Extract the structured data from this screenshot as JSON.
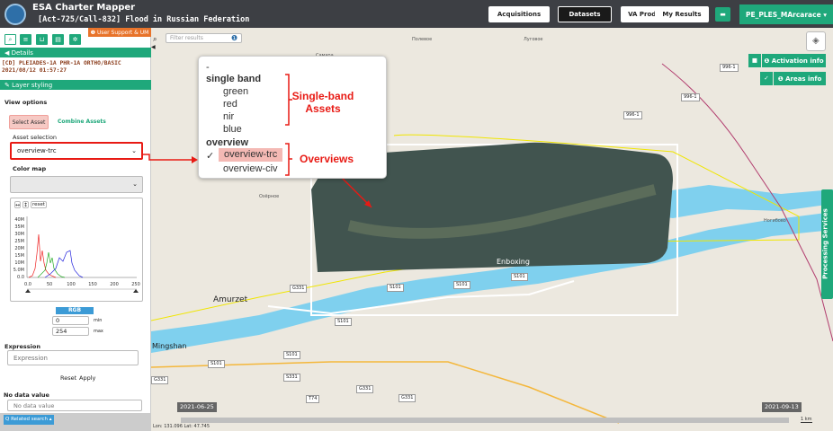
{
  "header": {
    "app_title": "ESA Charter Mapper",
    "subtitle": "[Act-725/Call-832] Flood in Russian Federation",
    "nav": [
      "Acquisitions",
      "Datasets",
      "VA Products",
      "My Results"
    ],
    "user": "PE_PLES_MArcarace ▾"
  },
  "panel": {
    "user_support": "❶ User Support & UM",
    "details_label": "Details",
    "dataset_title": "[CD] PLEIADES-1A PHR-1A ORTHO/BASIC 2021/08/12 01:57:27",
    "layer_styling": "Layer styling",
    "view_options": "View options",
    "tabs": [
      "Select Asset",
      "Combine Assets"
    ],
    "asset_selection_label": "Asset selection",
    "asset_value": "overview-trc",
    "color_map_label": "Color map",
    "hist_buttons": [
      "↔",
      "↕",
      "reset"
    ],
    "hist_y": [
      "40M",
      "35M",
      "30M",
      "25M",
      "20M",
      "15M",
      "10M",
      "5.0M",
      "0.0"
    ],
    "hist_x": [
      "0.0",
      "50",
      "100",
      "150",
      "200",
      "250"
    ],
    "rgb_label": "RGB",
    "min_value": "0",
    "min_label": "min",
    "max_value": "254",
    "max_label": "max",
    "expression_label": "Expression",
    "expression_placeholder": "Expression",
    "reset_label": "Reset",
    "apply_label": "Apply",
    "nodata_label": "No data value",
    "nodata_placeholder": "No data value",
    "related_search": "Q Related search ▴"
  },
  "map": {
    "filter_placeholder": "Filter results",
    "activation_info": "❶ Activation info",
    "areas_info": "❶ Areas info",
    "processing_services": "Processing Services",
    "places": [
      "Amurzet",
      "Mingshan",
      "Enboxing",
      "Самара",
      "Полевое",
      "Луговое",
      "Озёрное",
      "Ногибово"
    ],
    "roads": [
      "S101",
      "S101",
      "S101",
      "S101",
      "S101",
      "S101",
      "S331",
      "G331",
      "G331",
      "G331",
      "G331",
      "T74",
      "996-1",
      "996-1",
      "996-1",
      "996-1"
    ],
    "timeline_start": "2021-06-25",
    "timeline_end": "2021-09-13",
    "coords": "Lon: 131.096 Lat: 47.745",
    "scale": "1 km"
  },
  "popup": {
    "dash": "-",
    "group1": "single band",
    "bands": [
      "green",
      "red",
      "nir",
      "blue"
    ],
    "group2": "overview",
    "checkmark": "✓",
    "overviews": [
      "overview-trc",
      "overview-civ"
    ],
    "annot_single": "Single-band Assets",
    "annot_overview": "Overviews"
  }
}
